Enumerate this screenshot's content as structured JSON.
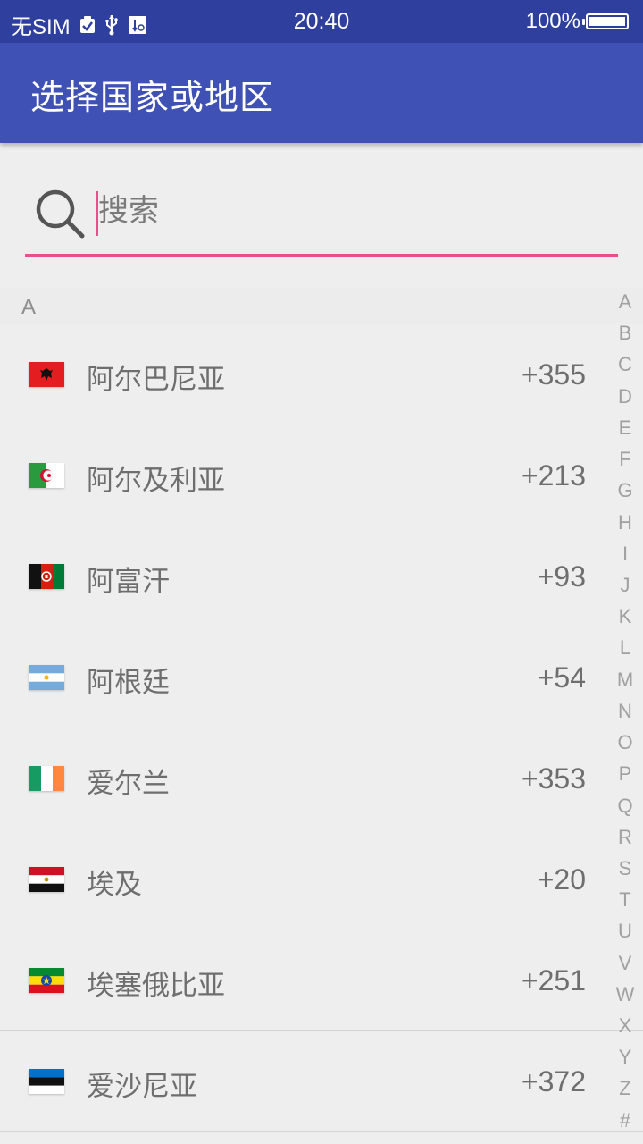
{
  "status_bar": {
    "carrier": "无SIM",
    "time": "20:40",
    "battery": "100%",
    "icons": [
      "checkmark-notification-icon",
      "usb-icon",
      "usb-debug-icon",
      "battery-icon"
    ]
  },
  "app_bar": {
    "title": "选择国家或地区"
  },
  "search": {
    "placeholder": "搜索",
    "value": "",
    "icon": "search-icon",
    "accent_color": "#e94f8a"
  },
  "list": {
    "section": "A",
    "items": [
      {
        "name": "阿尔巴尼亚",
        "code": "+355",
        "flag": "albania-flag"
      },
      {
        "name": "阿尔及利亚",
        "code": "+213",
        "flag": "algeria-flag"
      },
      {
        "name": "阿富汗",
        "code": "+93",
        "flag": "afghanistan-flag"
      },
      {
        "name": "阿根廷",
        "code": "+54",
        "flag": "argentina-flag"
      },
      {
        "name": "爱尔兰",
        "code": "+353",
        "flag": "ireland-flag"
      },
      {
        "name": "埃及",
        "code": "+20",
        "flag": "egypt-flag"
      },
      {
        "name": "埃塞俄比亚",
        "code": "+251",
        "flag": "ethiopia-flag"
      },
      {
        "name": "爱沙尼亚",
        "code": "+372",
        "flag": "estonia-flag"
      }
    ]
  },
  "index_bar": {
    "letters": [
      "A",
      "B",
      "C",
      "D",
      "E",
      "F",
      "G",
      "H",
      "I",
      "J",
      "K",
      "L",
      "M",
      "N",
      "O",
      "P",
      "Q",
      "R",
      "S",
      "T",
      "U",
      "V",
      "W",
      "X",
      "Y",
      "Z",
      "#"
    ]
  },
  "colors": {
    "status_bar": "#2f3f9e",
    "app_bar": "#3f51b5",
    "background": "#eeeeee"
  }
}
